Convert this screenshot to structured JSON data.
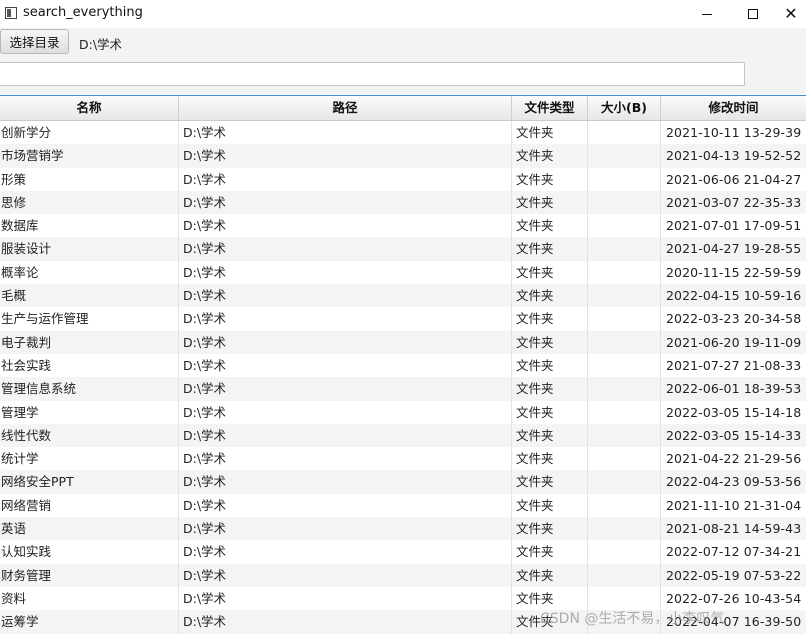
{
  "window": {
    "title": "search_everything",
    "minimize": "—",
    "maximize": "☐",
    "close": "✕"
  },
  "toolbar": {
    "choose_dir_label": "选择目录",
    "current_dir": "D:\\学术"
  },
  "search": {
    "value": "",
    "placeholder": ""
  },
  "table": {
    "columns": [
      "名称",
      "路径",
      "文件类型",
      "大小(B)",
      "修改时间"
    ],
    "rows": [
      {
        "name": "创新学分",
        "path": "D:\\学术",
        "type": "文件夹",
        "size": "",
        "modified": "2021-10-11 13-29-39"
      },
      {
        "name": "市场营销学",
        "path": "D:\\学术",
        "type": "文件夹",
        "size": "",
        "modified": "2021-04-13 19-52-52"
      },
      {
        "name": "形策",
        "path": "D:\\学术",
        "type": "文件夹",
        "size": "",
        "modified": "2021-06-06 21-04-27"
      },
      {
        "name": "思修",
        "path": "D:\\学术",
        "type": "文件夹",
        "size": "",
        "modified": "2021-03-07 22-35-33"
      },
      {
        "name": "数据库",
        "path": "D:\\学术",
        "type": "文件夹",
        "size": "",
        "modified": "2021-07-01 17-09-51"
      },
      {
        "name": "服装设计",
        "path": "D:\\学术",
        "type": "文件夹",
        "size": "",
        "modified": "2021-04-27 19-28-55"
      },
      {
        "name": "概率论",
        "path": "D:\\学术",
        "type": "文件夹",
        "size": "",
        "modified": "2020-11-15 22-59-59"
      },
      {
        "name": "毛概",
        "path": "D:\\学术",
        "type": "文件夹",
        "size": "",
        "modified": "2022-04-15 10-59-16"
      },
      {
        "name": "生产与运作管理",
        "path": "D:\\学术",
        "type": "文件夹",
        "size": "",
        "modified": "2022-03-23 20-34-58"
      },
      {
        "name": "电子裁判",
        "path": "D:\\学术",
        "type": "文件夹",
        "size": "",
        "modified": "2021-06-20 19-11-09"
      },
      {
        "name": "社会实践",
        "path": "D:\\学术",
        "type": "文件夹",
        "size": "",
        "modified": "2021-07-27 21-08-33"
      },
      {
        "name": "管理信息系统",
        "path": "D:\\学术",
        "type": "文件夹",
        "size": "",
        "modified": "2022-06-01 18-39-53"
      },
      {
        "name": "管理学",
        "path": "D:\\学术",
        "type": "文件夹",
        "size": "",
        "modified": "2022-03-05 15-14-18"
      },
      {
        "name": "线性代数",
        "path": "D:\\学术",
        "type": "文件夹",
        "size": "",
        "modified": "2022-03-05 15-14-33"
      },
      {
        "name": "统计学",
        "path": "D:\\学术",
        "type": "文件夹",
        "size": "",
        "modified": "2021-04-22 21-29-56"
      },
      {
        "name": "网络安全PPT",
        "path": "D:\\学术",
        "type": "文件夹",
        "size": "",
        "modified": "2022-04-23 09-53-56"
      },
      {
        "name": "网络营销",
        "path": "D:\\学术",
        "type": "文件夹",
        "size": "",
        "modified": "2021-11-10 21-31-04"
      },
      {
        "name": "英语",
        "path": "D:\\学术",
        "type": "文件夹",
        "size": "",
        "modified": "2021-08-21 14-59-43"
      },
      {
        "name": "认知实践",
        "path": "D:\\学术",
        "type": "文件夹",
        "size": "",
        "modified": "2022-07-12 07-34-21"
      },
      {
        "name": "财务管理",
        "path": "D:\\学术",
        "type": "文件夹",
        "size": "",
        "modified": "2022-05-19 07-53-22"
      },
      {
        "name": "资料",
        "path": "D:\\学术",
        "type": "文件夹",
        "size": "",
        "modified": "2022-07-26 10-43-54"
      },
      {
        "name": "运筹学",
        "path": "D:\\学术",
        "type": "文件夹",
        "size": "",
        "modified": "2022-04-07 16-39-50"
      }
    ]
  },
  "watermark": "CSDN @生活不易，小李叹气",
  "colors": {
    "header_accent": "#3a8fd9",
    "alt_row": "#f4f4f4"
  }
}
